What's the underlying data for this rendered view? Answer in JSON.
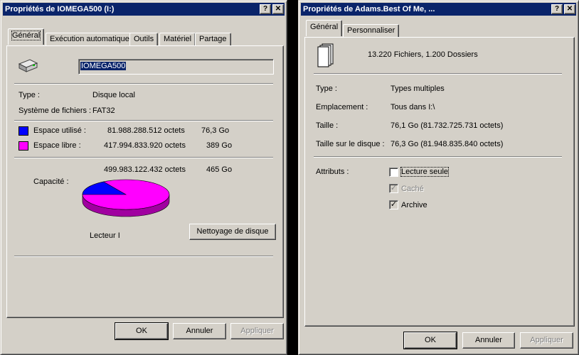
{
  "colors": {
    "titlebar": "#0a246a",
    "face": "#d4d0c8",
    "used": "#0000ff",
    "free": "#ff00ff"
  },
  "drive_dialog": {
    "title": "Propriétés de IOMEGA500 (I:)",
    "tabs": [
      "Général",
      "Exécution automatique",
      "Outils",
      "Matériel",
      "Partage"
    ],
    "icon": "hard-drive-icon",
    "volume_label": "IOMEGA500",
    "type_label": "Type :",
    "type_value": "Disque local",
    "fs_label": "Système de fichiers :",
    "fs_value": "FAT32",
    "used_label": "Espace utilisé :",
    "used_bytes": "81.988.288.512 octets",
    "used_size": "76,3 Go",
    "free_label": "Espace libre :",
    "free_bytes": "417.994.833.920 octets",
    "free_size": "389 Go",
    "capacity_label": "Capacité :",
    "capacity_bytes": "499.983.122.432 octets",
    "capacity_size": "465 Go",
    "drive_caption": "Lecteur I",
    "cleanup_button": "Nettoyage de disque",
    "used_fraction": 0.164,
    "ok": "OK",
    "cancel": "Annuler",
    "apply": "Appliquer"
  },
  "folder_dialog": {
    "title": "Propriétés de Adams.Best Of Me, ...",
    "tabs": [
      "Général",
      "Personnaliser"
    ],
    "icon": "multiple-files-icon",
    "summary": "13.220 Fichiers, 1.200 Dossiers",
    "type_label": "Type :",
    "type_value": "Types multiples",
    "location_label": "Emplacement :",
    "location_value": "Tous dans I:\\",
    "size_label": "Taille :",
    "size_value": "76,1 Go (81.732.725.731 octets)",
    "disk_size_label": "Taille sur le disque :",
    "disk_size_value": "76,3 Go (81.948.835.840 octets)",
    "attributes_label": "Attributs :",
    "attr_readonly": "Lecture seule",
    "attr_hidden": "Caché",
    "attr_archive": "Archive",
    "ok": "OK",
    "cancel": "Annuler",
    "apply": "Appliquer"
  }
}
